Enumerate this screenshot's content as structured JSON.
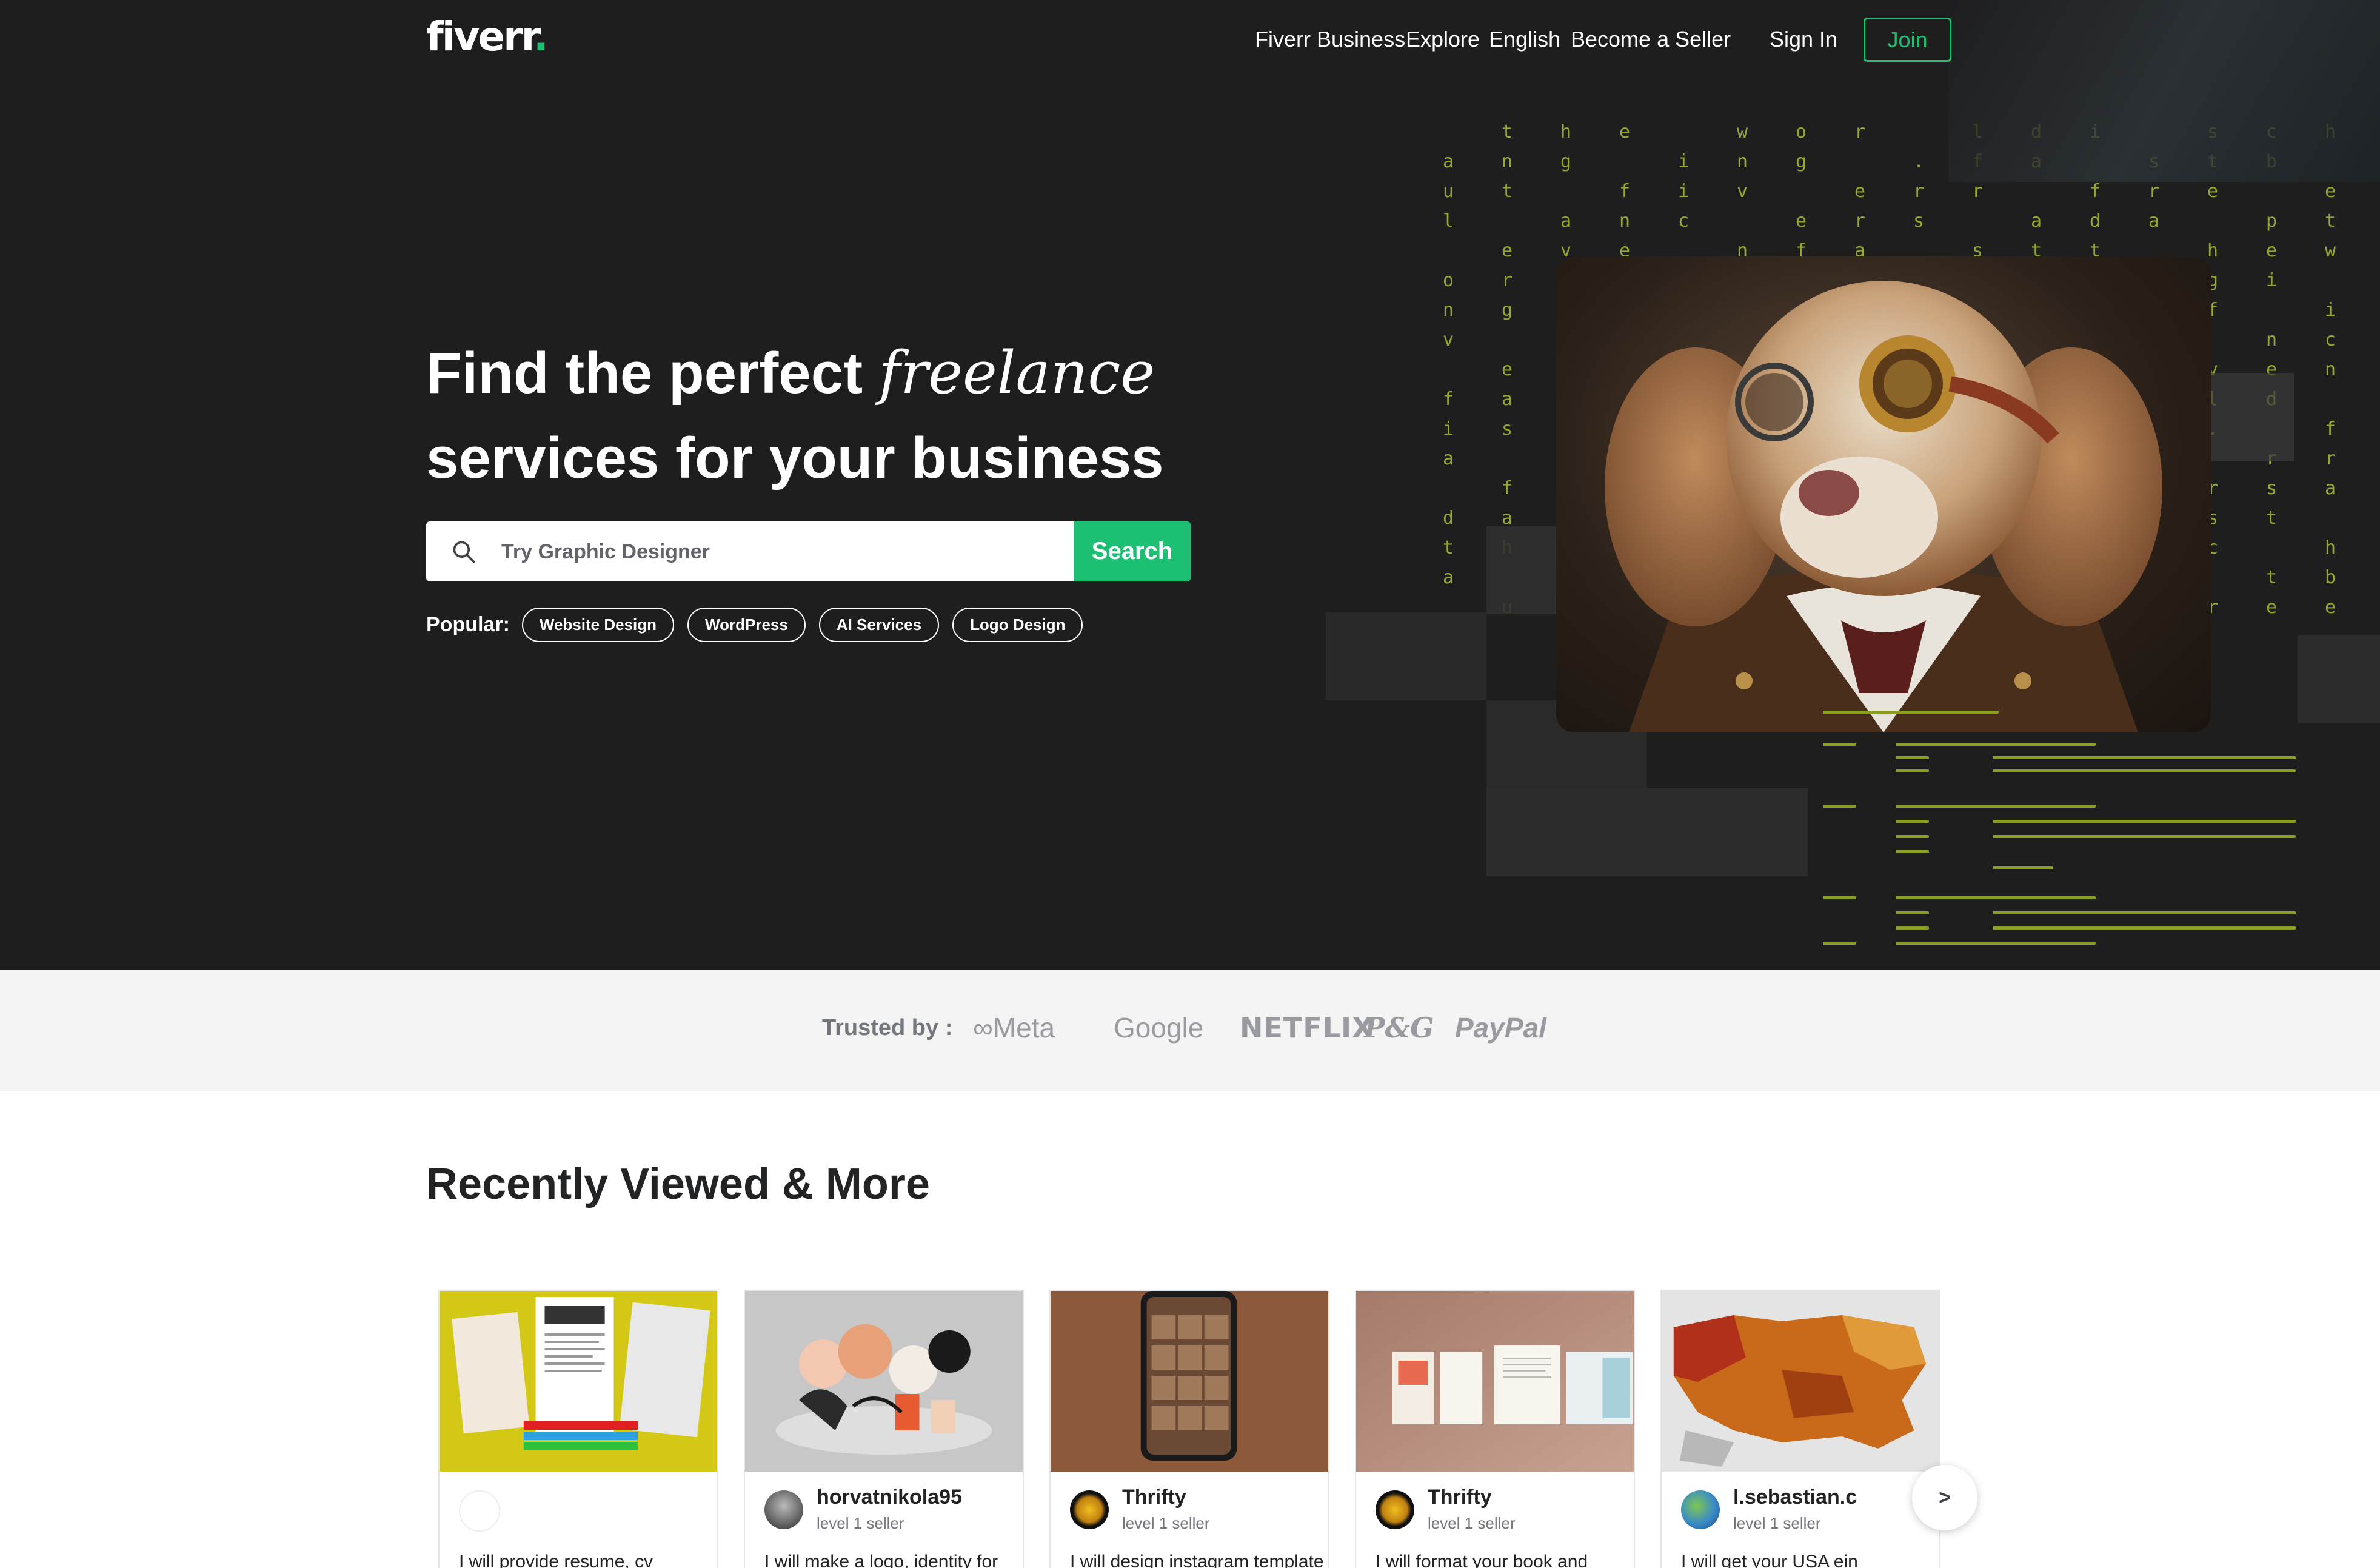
{
  "nav": {
    "logo": "fiverr",
    "logo_dot": ".",
    "links": [
      "Fiverr Business",
      "Explore",
      "English",
      "Become a Seller"
    ],
    "sign_in": "Sign In",
    "join": "Join"
  },
  "hero": {
    "headline_part1": "Find the perfect ",
    "headline_italic": "freelance",
    "headline_line2": "services for your business",
    "search_placeholder": "Try Graphic Designer",
    "search_button": "Search",
    "popular_label": "Popular:",
    "popular_chips": [
      "Website Design",
      "WordPress",
      "AI Services",
      "Logo Design"
    ],
    "background_letters": [
      "t",
      "h",
      "e",
      "w",
      "o",
      "r",
      "l",
      "d",
      "i",
      "s",
      "c",
      "h",
      "a",
      "n",
      "g",
      "i",
      "n",
      "g",
      ".",
      "f",
      "a",
      "s",
      "t",
      "b",
      "u",
      "t",
      "f",
      "i",
      "v",
      "e",
      "r",
      "r",
      "f",
      "r",
      "e",
      "e",
      "l",
      "a",
      "n",
      "c",
      "e",
      "r",
      "s",
      "a",
      "d",
      "a",
      "p",
      "t",
      "e",
      "v",
      "e",
      "n",
      "f",
      "a",
      "s",
      "t"
    ]
  },
  "trusted": {
    "label": "Trusted by :",
    "brands": [
      "Meta",
      "Google",
      "NETFLIX",
      "P&G",
      "PayPal"
    ]
  },
  "recently_viewed": {
    "title": "Recently Viewed & More",
    "cards": [
      {
        "seller": "",
        "level": "",
        "desc": "I will provide resume, cv"
      },
      {
        "seller": "horvatnikola95",
        "level": "level 1 seller",
        "desc": "I will make a logo, identity for"
      },
      {
        "seller": "Thrifty",
        "level": "level 1 seller",
        "desc": "I will design instagram template"
      },
      {
        "seller": "Thrifty",
        "level": "level 1 seller",
        "desc": "I will format your book and"
      },
      {
        "seller": "l.sebastian.c",
        "level": "level 1 seller",
        "desc": "I will get your USA ein"
      }
    ],
    "next_label": ">"
  },
  "colors": {
    "hero_bg": "#1e1e1f",
    "accent": "#1dbf73",
    "code_green": "#97a82e"
  }
}
